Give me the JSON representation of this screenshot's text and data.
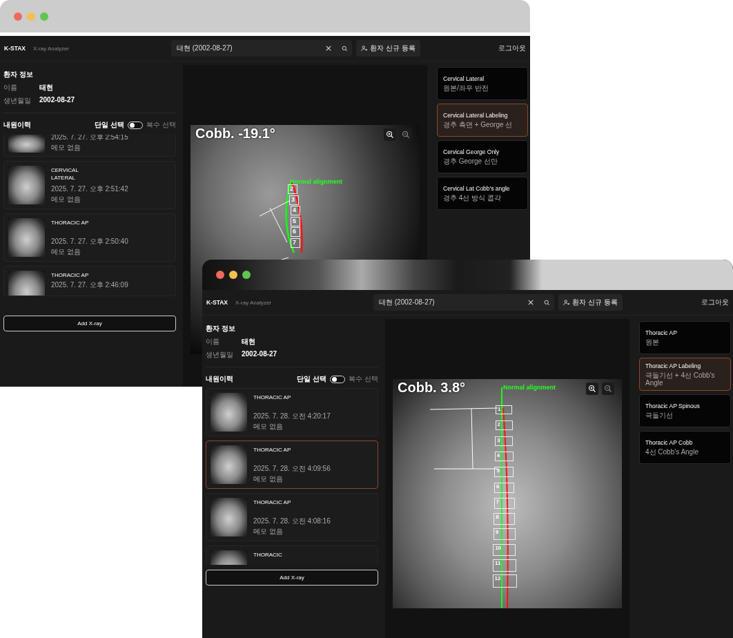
{
  "windows": [
    {
      "app": {
        "logo": "K-STAX",
        "subtitle": "X-ray Analyzer"
      },
      "search": {
        "value": "태현 (2002-08-27)"
      },
      "register_button": "환자 신규 등록",
      "logout": "로그아웃",
      "patient": {
        "title": "환자 정보",
        "fields": [
          {
            "label": "이름",
            "value": "태현"
          },
          {
            "label": "생년월일",
            "value": "2002-08-27"
          }
        ]
      },
      "history": {
        "title": "내원이력",
        "toggle": {
          "left_label": "단일 선택",
          "right_label": "복수 선택",
          "on": false
        },
        "items": [
          {
            "kind": "top-cut",
            "time": "2025. 7. 27. 오후 2:54:15",
            "memo": "메모 없음",
            "selected": false
          },
          {
            "kind": "full",
            "title": "CERVICAL LATERAL",
            "time": "2025. 7. 27. 오후 2:51:42",
            "memo": "메모 없음",
            "selected": false
          },
          {
            "kind": "full",
            "title": "THORACIC AP",
            "time": "2025. 7. 27. 오후 2:50:40",
            "memo": "메모 없음",
            "selected": false
          },
          {
            "kind": "bottom-cut",
            "title": "THORACIC AP",
            "time": "2025. 7. 27. 오후 2:46:09",
            "selected": false
          }
        ]
      },
      "add_button": "Add X-ray",
      "viewer": {
        "kind": "lateral",
        "cobb": "Cobb. -19.1°",
        "alignment": "Normal alignment",
        "vertebrae": [
          "2",
          "3",
          "4",
          "5",
          "6",
          "7"
        ]
      },
      "analyses": [
        {
          "title": "Cervical Lateral",
          "subtitle": "원본/좌우 반전",
          "selected": false
        },
        {
          "title": "Cervical Lateral Labeling",
          "subtitle": "경추 측면 + George 선",
          "selected": true
        },
        {
          "title": "Cervical George Only",
          "subtitle": "경추 George 선만",
          "selected": false
        },
        {
          "title": "Cervical Lat Cobb's angle",
          "subtitle": "경추 4선 방식 콥각",
          "selected": false
        }
      ]
    },
    {
      "app": {
        "logo": "K-STAX",
        "subtitle": "X-ray Analyzer"
      },
      "search": {
        "value": "태현 (2002-08-27)"
      },
      "register_button": "환자 신규 등록",
      "logout": "로그아웃",
      "patient": {
        "title": "환자 정보",
        "fields": [
          {
            "label": "이름",
            "value": "태현"
          },
          {
            "label": "생년월일",
            "value": "2002-08-27"
          }
        ]
      },
      "history": {
        "title": "내원이력",
        "toggle": {
          "left_label": "단일 선택",
          "right_label": "복수 선택",
          "on": false
        },
        "items": [
          {
            "kind": "full",
            "title": "THORACIC AP",
            "time": "2025. 7. 28. 오전 4:20:17",
            "memo": "메모 없음",
            "selected": false
          },
          {
            "kind": "full",
            "title": "THORACIC AP",
            "time": "2025. 7. 28. 오전 4:09:56",
            "memo": "메모 없음",
            "selected": true
          },
          {
            "kind": "full",
            "title": "THORACIC AP",
            "time": "2025. 7. 28. 오전 4:08:16",
            "memo": "메모 없음",
            "selected": false
          },
          {
            "kind": "bottom-cut",
            "title": "THORACIC",
            "selected": false
          }
        ]
      },
      "add_button": "Add X-ray",
      "viewer": {
        "kind": "ap",
        "cobb": "Cobb. 3.8°",
        "alignment": "Normal alignment",
        "vertebrae": [
          "1",
          "2",
          "3",
          "4",
          "5",
          "6",
          "7",
          "8",
          "9",
          "10",
          "11",
          "12"
        ]
      },
      "analyses": [
        {
          "title": "Thoracic AP",
          "subtitle": "원본",
          "selected": false
        },
        {
          "title": "Thoracic AP Labeling",
          "subtitle": "극돌기선 + 4선 Cobb's Angle",
          "selected": true
        },
        {
          "title": "Thoracic AP Spinous",
          "subtitle": "극돌기선",
          "selected": false
        },
        {
          "title": "Thoracic AP Cobb",
          "subtitle": "4선 Cobb's Angle",
          "selected": false
        }
      ]
    }
  ]
}
